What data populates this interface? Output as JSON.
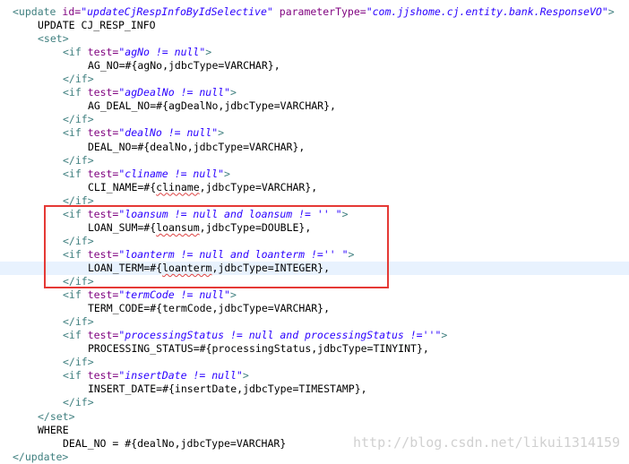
{
  "editor": {
    "lines": [
      {
        "indent": 0,
        "kind": "open-tag-attrs",
        "tag": "<update",
        "attrs": [
          {
            "name": "id",
            "value": "updateCjRespInfoByIdSelective"
          },
          {
            "name": "parameterType",
            "value": "com.jjshome.cj.entity.bank.ResponseVO"
          }
        ],
        "close": ">"
      },
      {
        "indent": 1,
        "kind": "sql",
        "text": "UPDATE CJ_RESP_INFO"
      },
      {
        "indent": 1,
        "kind": "tag",
        "text": "<set>"
      },
      {
        "indent": 2,
        "kind": "if",
        "test": "agNo != null"
      },
      {
        "indent": 3,
        "kind": "sql",
        "text": "AG_NO=#{agNo,jdbcType=VARCHAR},"
      },
      {
        "indent": 2,
        "kind": "tag",
        "text": "</if>"
      },
      {
        "indent": 2,
        "kind": "if",
        "test": "agDealNo != null"
      },
      {
        "indent": 3,
        "kind": "sql",
        "text": "AG_DEAL_NO=#{agDealNo,jdbcType=VARCHAR},"
      },
      {
        "indent": 2,
        "kind": "tag",
        "text": "</if>"
      },
      {
        "indent": 2,
        "kind": "if",
        "test": "dealNo != null"
      },
      {
        "indent": 3,
        "kind": "sql",
        "text": "DEAL_NO=#{dealNo,jdbcType=VARCHAR},"
      },
      {
        "indent": 2,
        "kind": "tag",
        "text": "</if>"
      },
      {
        "indent": 2,
        "kind": "if",
        "test": "cliname != null"
      },
      {
        "indent": 3,
        "kind": "sql",
        "text": "CLI_NAME=#{cliname,jdbcType=VARCHAR},"
      },
      {
        "indent": 2,
        "kind": "tag",
        "text": "</if>"
      },
      {
        "indent": 2,
        "kind": "if",
        "test": "loansum != null and loansum != '' "
      },
      {
        "indent": 3,
        "kind": "sql",
        "text": "LOAN_SUM=#{loansum,jdbcType=DOUBLE},"
      },
      {
        "indent": 2,
        "kind": "tag",
        "text": "</if>"
      },
      {
        "indent": 2,
        "kind": "if",
        "test": "loanterm != null and loanterm !='' "
      },
      {
        "indent": 3,
        "kind": "sql",
        "text": "LOAN_TERM=#{loanterm,jdbcType=INTEGER},",
        "current": true
      },
      {
        "indent": 2,
        "kind": "tag",
        "text": "</if>"
      },
      {
        "indent": 2,
        "kind": "if",
        "test": "termCode != null"
      },
      {
        "indent": 3,
        "kind": "sql",
        "text": "TERM_CODE=#{termCode,jdbcType=VARCHAR},"
      },
      {
        "indent": 2,
        "kind": "tag",
        "text": "</if>"
      },
      {
        "indent": 2,
        "kind": "if",
        "test": "processingStatus != null and processingStatus !=''"
      },
      {
        "indent": 3,
        "kind": "sql",
        "text": "PROCESSING_STATUS=#{processingStatus,jdbcType=TINYINT},"
      },
      {
        "indent": 2,
        "kind": "tag",
        "text": "</if>"
      },
      {
        "indent": 2,
        "kind": "if",
        "test": "insertDate != null"
      },
      {
        "indent": 3,
        "kind": "sql",
        "text": "INSERT_DATE=#{insertDate,jdbcType=TIMESTAMP},"
      },
      {
        "indent": 2,
        "kind": "tag",
        "text": "</if>"
      },
      {
        "indent": 1,
        "kind": "tag",
        "text": "</set>"
      },
      {
        "indent": 1,
        "kind": "sql",
        "text": "WHERE"
      },
      {
        "indent": 2,
        "kind": "sql",
        "text": "DEAL_NO = #{dealNo,jdbcType=VARCHAR}"
      },
      {
        "indent": 0,
        "kind": "tag",
        "text": "</update>"
      }
    ]
  },
  "watermark": {
    "text": "http://blog.csdn.net/likui1314159"
  },
  "colors": {
    "tag": "#3f7f7f",
    "attribute": "#7f007f",
    "attribute_value": "#2a00ff",
    "sql_text": "#000000",
    "highlight_box": "#e53935",
    "current_line": "#e8f2fe"
  }
}
